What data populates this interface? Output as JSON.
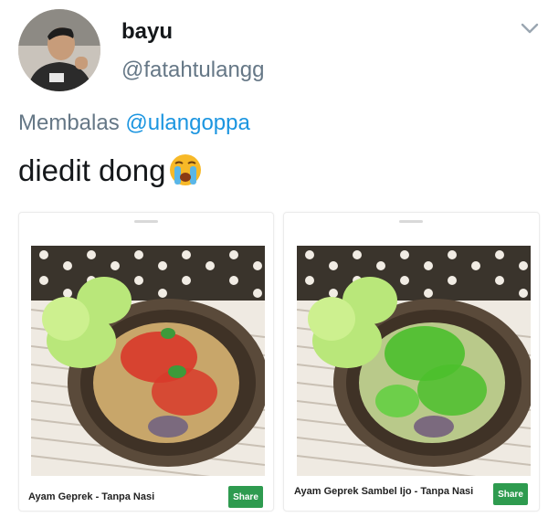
{
  "tweet": {
    "user": {
      "name": "bayu",
      "handle": "@fatahtulangg"
    },
    "reply": {
      "prefix": "Membalas ",
      "mention": "@ulangoppa"
    },
    "text": "diedit dong",
    "emoji": "loudly-crying-face-icon"
  },
  "cards": [
    {
      "title": "Ayam Geprek - Tanpa Nasi",
      "share_label": "Share",
      "sambal_color": "#d8392a"
    },
    {
      "title": "Ayam Geprek Sambel Ijo - Tanpa Nasi",
      "share_label": "Share",
      "sambal_color": "#4bbf2c"
    }
  ],
  "colors": {
    "link": "#1b95e0",
    "muted": "#657786",
    "share_button": "#2e9b4f"
  }
}
